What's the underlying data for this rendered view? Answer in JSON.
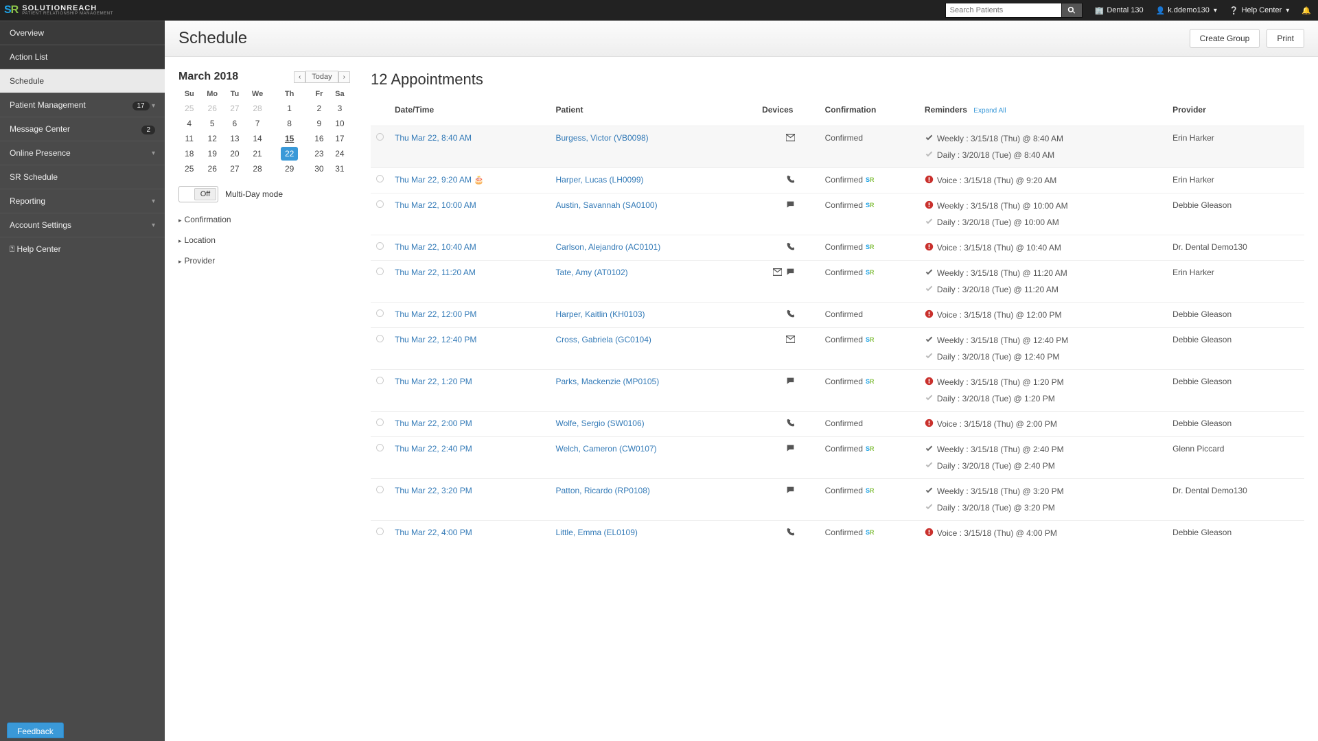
{
  "brand": {
    "name": "SOLUTIONREACH",
    "subtitle": "PATIENT RELATIONSHIP MANAGEMENT"
  },
  "topbar": {
    "searchPlaceholder": "Search Patients",
    "office": "Dental 130",
    "user": "k.ddemo130",
    "help": "Help Center"
  },
  "nav": {
    "overview": "Overview",
    "actionList": "Action List",
    "schedule": "Schedule",
    "patientMgmt": "Patient Management",
    "patientMgmtBadge": "17",
    "msgCenter": "Message Center",
    "msgCenterBadge": "2",
    "onlinePresence": "Online Presence",
    "srSchedule": "SR Schedule",
    "reporting": "Reporting",
    "accountSettings": "Account Settings",
    "helpCenter": "Help Center",
    "feedback": "Feedback"
  },
  "page": {
    "title": "Schedule",
    "createGroup": "Create Group",
    "print": "Print"
  },
  "calendar": {
    "title": "March 2018",
    "today": "Today",
    "dow": [
      "Su",
      "Mo",
      "Tu",
      "We",
      "Th",
      "Fr",
      "Sa"
    ],
    "weeks": [
      [
        {
          "d": "25",
          "o": true
        },
        {
          "d": "26",
          "o": true
        },
        {
          "d": "27",
          "o": true
        },
        {
          "d": "28",
          "o": true
        },
        {
          "d": "1"
        },
        {
          "d": "2"
        },
        {
          "d": "3"
        }
      ],
      [
        {
          "d": "4"
        },
        {
          "d": "5"
        },
        {
          "d": "6"
        },
        {
          "d": "7"
        },
        {
          "d": "8"
        },
        {
          "d": "9"
        },
        {
          "d": "10"
        }
      ],
      [
        {
          "d": "11"
        },
        {
          "d": "12"
        },
        {
          "d": "13"
        },
        {
          "d": "14"
        },
        {
          "d": "15",
          "today": true
        },
        {
          "d": "16"
        },
        {
          "d": "17"
        }
      ],
      [
        {
          "d": "18"
        },
        {
          "d": "19"
        },
        {
          "d": "20"
        },
        {
          "d": "21"
        },
        {
          "d": "22",
          "sel": true
        },
        {
          "d": "23"
        },
        {
          "d": "24"
        }
      ],
      [
        {
          "d": "25"
        },
        {
          "d": "26"
        },
        {
          "d": "27"
        },
        {
          "d": "28"
        },
        {
          "d": "29"
        },
        {
          "d": "30"
        },
        {
          "d": "31"
        }
      ]
    ],
    "multiDayLabel": "Multi-Day mode",
    "toggleOff": "Off",
    "filters": [
      "Confirmation",
      "Location",
      "Provider"
    ]
  },
  "appts": {
    "title": "12 Appointments",
    "cols": {
      "datetime": "Date/Time",
      "patient": "Patient",
      "devices": "Devices",
      "confirmation": "Confirmation",
      "reminders": "Reminders",
      "provider": "Provider"
    },
    "expandAll": "Expand All",
    "rows": [
      {
        "dt": "Thu Mar 22, 8:40 AM",
        "patient": "Burgess, Victor (VB0098)",
        "devices": [
          "mail"
        ],
        "conf": "Confirmed",
        "sr": false,
        "reminders": [
          {
            "ico": "check-dark",
            "text": "Weekly : 3/15/18 (Thu) @ 8:40 AM"
          },
          {
            "ico": "check",
            "text": "Daily : 3/20/18 (Tue) @ 8:40 AM"
          }
        ],
        "provider": "Erin Harker"
      },
      {
        "dt": "Thu Mar 22, 9:20 AM",
        "patient": "Harper, Lucas (LH0099)",
        "devices": [
          "phone"
        ],
        "cake": true,
        "conf": "Confirmed",
        "sr": true,
        "reminders": [
          {
            "ico": "alert",
            "text": "Voice : 3/15/18 (Thu) @ 9:20 AM"
          }
        ],
        "provider": "Erin Harker"
      },
      {
        "dt": "Thu Mar 22, 10:00 AM",
        "patient": "Austin, Savannah (SA0100)",
        "devices": [
          "chat"
        ],
        "conf": "Confirmed",
        "sr": true,
        "reminders": [
          {
            "ico": "alert",
            "text": "Weekly : 3/15/18 (Thu) @ 10:00 AM"
          },
          {
            "ico": "check",
            "text": "Daily : 3/20/18 (Tue) @ 10:00 AM"
          }
        ],
        "provider": "Debbie Gleason"
      },
      {
        "dt": "Thu Mar 22, 10:40 AM",
        "patient": "Carlson, Alejandro (AC0101)",
        "devices": [
          "phone"
        ],
        "conf": "Confirmed",
        "sr": true,
        "reminders": [
          {
            "ico": "alert",
            "text": "Voice : 3/15/18 (Thu) @ 10:40 AM"
          }
        ],
        "provider": "Dr. Dental Demo130"
      },
      {
        "dt": "Thu Mar 22, 11:20 AM",
        "patient": "Tate, Amy (AT0102)",
        "devices": [
          "mail",
          "chat"
        ],
        "conf": "Confirmed",
        "sr": true,
        "reminders": [
          {
            "ico": "check-dark",
            "text": "Weekly : 3/15/18 (Thu) @ 11:20 AM"
          },
          {
            "ico": "check",
            "text": "Daily : 3/20/18 (Tue) @ 11:20 AM"
          }
        ],
        "provider": "Erin Harker"
      },
      {
        "dt": "Thu Mar 22, 12:00 PM",
        "patient": "Harper, Kaitlin (KH0103)",
        "devices": [
          "phone"
        ],
        "conf": "Confirmed",
        "sr": false,
        "reminders": [
          {
            "ico": "alert",
            "text": "Voice : 3/15/18 (Thu) @ 12:00 PM"
          }
        ],
        "provider": "Debbie Gleason"
      },
      {
        "dt": "Thu Mar 22, 12:40 PM",
        "patient": "Cross, Gabriela (GC0104)",
        "devices": [
          "mail"
        ],
        "conf": "Confirmed",
        "sr": true,
        "reminders": [
          {
            "ico": "check-dark",
            "text": "Weekly : 3/15/18 (Thu) @ 12:40 PM"
          },
          {
            "ico": "check",
            "text": "Daily : 3/20/18 (Tue) @ 12:40 PM"
          }
        ],
        "provider": "Debbie Gleason"
      },
      {
        "dt": "Thu Mar 22, 1:20 PM",
        "patient": "Parks, Mackenzie (MP0105)",
        "devices": [
          "chat"
        ],
        "conf": "Confirmed",
        "sr": true,
        "reminders": [
          {
            "ico": "alert",
            "text": "Weekly : 3/15/18 (Thu) @ 1:20 PM"
          },
          {
            "ico": "check",
            "text": "Daily : 3/20/18 (Tue) @ 1:20 PM"
          }
        ],
        "provider": "Debbie Gleason"
      },
      {
        "dt": "Thu Mar 22, 2:00 PM",
        "patient": "Wolfe, Sergio (SW0106)",
        "devices": [
          "phone"
        ],
        "conf": "Confirmed",
        "sr": false,
        "reminders": [
          {
            "ico": "alert",
            "text": "Voice : 3/15/18 (Thu) @ 2:00 PM"
          }
        ],
        "provider": "Debbie Gleason"
      },
      {
        "dt": "Thu Mar 22, 2:40 PM",
        "patient": "Welch, Cameron (CW0107)",
        "devices": [
          "chat"
        ],
        "conf": "Confirmed",
        "sr": true,
        "reminders": [
          {
            "ico": "check-dark",
            "text": "Weekly : 3/15/18 (Thu) @ 2:40 PM"
          },
          {
            "ico": "check",
            "text": "Daily : 3/20/18 (Tue) @ 2:40 PM"
          }
        ],
        "provider": "Glenn Piccard"
      },
      {
        "dt": "Thu Mar 22, 3:20 PM",
        "patient": "Patton, Ricardo (RP0108)",
        "devices": [
          "chat"
        ],
        "conf": "Confirmed",
        "sr": true,
        "reminders": [
          {
            "ico": "check-dark",
            "text": "Weekly : 3/15/18 (Thu) @ 3:20 PM"
          },
          {
            "ico": "check",
            "text": "Daily : 3/20/18 (Tue) @ 3:20 PM"
          }
        ],
        "provider": "Dr. Dental Demo130"
      },
      {
        "dt": "Thu Mar 22, 4:00 PM",
        "patient": "Little, Emma (EL0109)",
        "devices": [
          "phone"
        ],
        "conf": "Confirmed",
        "sr": true,
        "reminders": [
          {
            "ico": "alert",
            "text": "Voice : 3/15/18 (Thu) @ 4:00 PM"
          }
        ],
        "provider": "Debbie Gleason"
      }
    ]
  }
}
